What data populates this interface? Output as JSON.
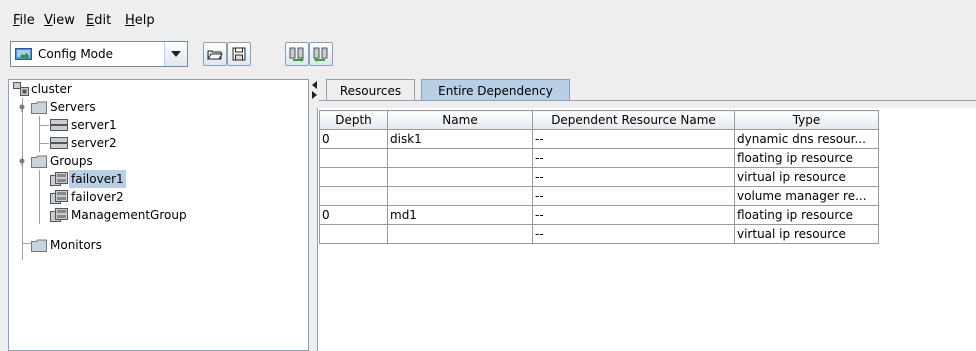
{
  "menubar": {
    "items": [
      {
        "label": "File",
        "mnemonic": "F",
        "rest": "ile"
      },
      {
        "label": "View",
        "mnemonic": "V",
        "rest": "iew"
      },
      {
        "label": "Edit",
        "mnemonic": "E",
        "rest": "dit"
      },
      {
        "label": "Help",
        "mnemonic": "H",
        "rest": "elp"
      }
    ]
  },
  "toolbar": {
    "mode_selected": "Config Mode",
    "buttons": [
      "open-icon",
      "save-icon",
      "get-configuration-icon",
      "apply-configuration-icon"
    ]
  },
  "tree": {
    "root": "cluster",
    "servers_label": "Servers",
    "servers": [
      "server1",
      "server2"
    ],
    "groups_label": "Groups",
    "groups": [
      "failover1",
      "failover2",
      "ManagementGroup"
    ],
    "selected_group": "failover1",
    "monitors_label": "Monitors"
  },
  "tabs": [
    {
      "label": "Resources",
      "active": false
    },
    {
      "label": "Entire Dependency",
      "active": true
    }
  ],
  "table": {
    "columns": [
      "Depth",
      "Name",
      "Dependent Resource Name",
      "Type"
    ],
    "rows": [
      [
        "0",
        "disk1",
        "--",
        "dynamic dns resour..."
      ],
      [
        "",
        "",
        "--",
        "floating ip resource"
      ],
      [
        "",
        "",
        "--",
        "virtual ip resource"
      ],
      [
        "",
        "",
        "--",
        "volume manager re..."
      ],
      [
        "0",
        "md1",
        "--",
        "floating ip resource"
      ],
      [
        "",
        "",
        "--",
        "virtual ip resource"
      ]
    ]
  },
  "colors": {
    "selection": "#b8cfe5",
    "folder": "#c8d3dd",
    "border": "#8da0b6"
  }
}
